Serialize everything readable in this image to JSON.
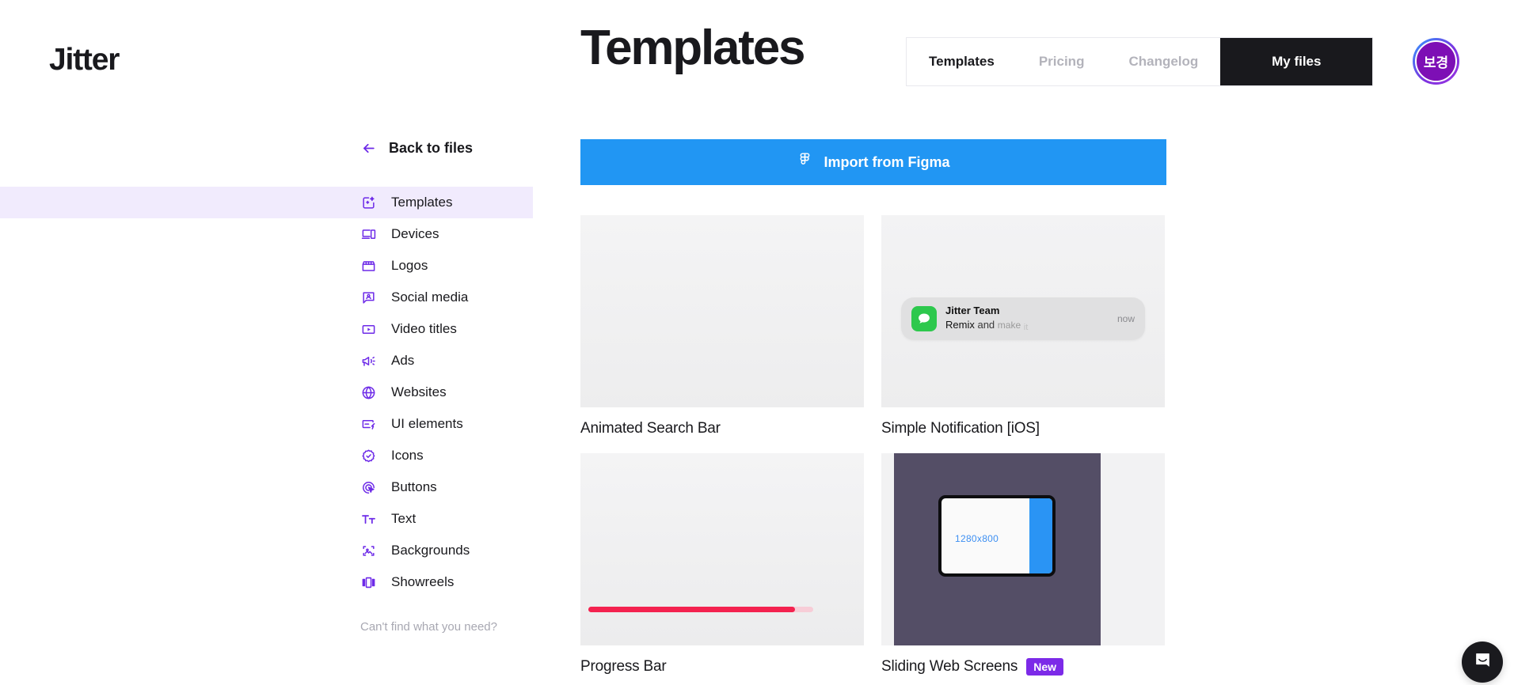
{
  "brand": {
    "logo_text": "Jitter"
  },
  "header": {
    "page_title": "Templates",
    "nav": [
      {
        "label": "Templates",
        "active": true
      },
      {
        "label": "Pricing",
        "active": false
      },
      {
        "label": "Changelog",
        "active": false
      }
    ],
    "cta_label": "My files",
    "avatar_initials": "보경"
  },
  "sidebar": {
    "back_label": "Back to files",
    "back_icon": "arrow-left-icon",
    "items": [
      {
        "label": "Templates",
        "icon": "templates-sparkle-icon",
        "active": true
      },
      {
        "label": "Devices",
        "icon": "devices-icon",
        "active": false
      },
      {
        "label": "Logos",
        "icon": "storefront-icon",
        "active": false
      },
      {
        "label": "Social media",
        "icon": "social-media-icon",
        "active": false
      },
      {
        "label": "Video titles",
        "icon": "video-play-icon",
        "active": false
      },
      {
        "label": "Ads",
        "icon": "megaphone-icon",
        "active": false
      },
      {
        "label": "Websites",
        "icon": "globe-icon",
        "active": false
      },
      {
        "label": "UI elements",
        "icon": "ui-elements-icon",
        "active": false
      },
      {
        "label": "Icons",
        "icon": "badge-check-icon",
        "active": false
      },
      {
        "label": "Buttons",
        "icon": "cursor-click-icon",
        "active": false
      },
      {
        "label": "Text",
        "icon": "text-size-icon",
        "active": false
      },
      {
        "label": "Backgrounds",
        "icon": "image-frame-icon",
        "active": false
      },
      {
        "label": "Showreels",
        "icon": "showreel-icon",
        "active": false
      }
    ],
    "footer_text": "Can't find what you need?"
  },
  "main": {
    "import_button": {
      "label": "Import from Figma",
      "icon": "figma-icon"
    },
    "cards": [
      {
        "title": "Animated Search Bar",
        "badge": null,
        "preview": {
          "kind": "blank-search"
        }
      },
      {
        "title": "Simple Notification [iOS]",
        "badge": null,
        "preview": {
          "kind": "ios-notification",
          "app_icon": "messages-icon",
          "app_name": "Jitter Team",
          "message_words": [
            "Remix",
            "and",
            "make",
            "it"
          ],
          "time": "now"
        }
      },
      {
        "title": "Progress Bar",
        "badge": null,
        "preview": {
          "kind": "progress-bar",
          "progress_percent": 92
        }
      },
      {
        "title": "Sliding Web Screens",
        "badge": "New",
        "preview": {
          "kind": "sliding-web-screens",
          "screen_label": "1280x800"
        }
      }
    ]
  },
  "chat": {
    "icon": "intercom-chat-icon"
  },
  "colors": {
    "accent_purple": "#7c2ae8",
    "sidebar_icon": "#6d2ae8",
    "sidebar_active_bg": "#f1ebfd",
    "figma_blue": "#2196f3",
    "progress_red": "#f4224f",
    "progress_track": "#f7cdd7",
    "notification_green": "#2dc84d",
    "slide_bg": "#544e66",
    "slide_panel_blue": "#2a94f4",
    "text_dark": "#19191d",
    "text_muted": "#b3b3bb"
  }
}
